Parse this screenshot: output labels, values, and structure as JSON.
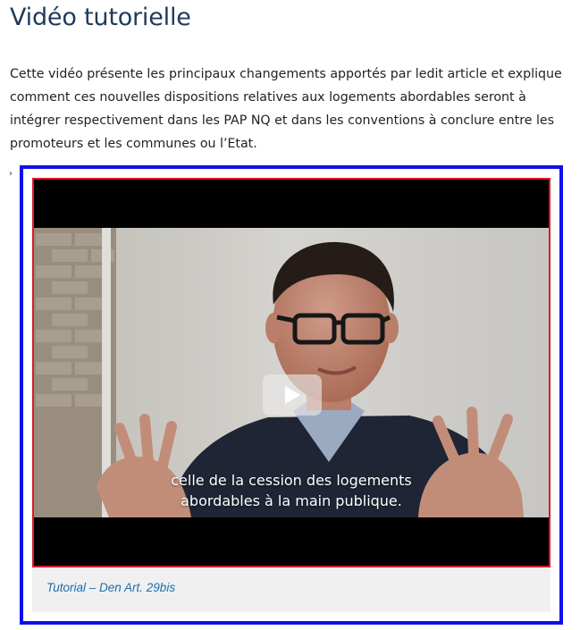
{
  "section": {
    "title": "Vidéo tutorielle",
    "intro": "Cette vidéo présente les principaux changements apportés par ledit article et explique comment ces nouvelles dispositions relatives aux logements abordables seront à intégrer respectivement dans les PAP NQ et dans les conventions à conclure entre les promoteurs et les communes ou l’Etat.",
    "caret": "›"
  },
  "video": {
    "subtitle_lines": [
      "celle de la cession des logements",
      "abordables à la main publique."
    ],
    "play_icon": "play-icon",
    "caption": "Tutorial – Den Art. 29bis"
  },
  "colors": {
    "title": "#1f3a5a",
    "caption_link": "#1b6ea8",
    "outer_highlight": "#1010e8",
    "video_highlight": "#d81b2a"
  }
}
